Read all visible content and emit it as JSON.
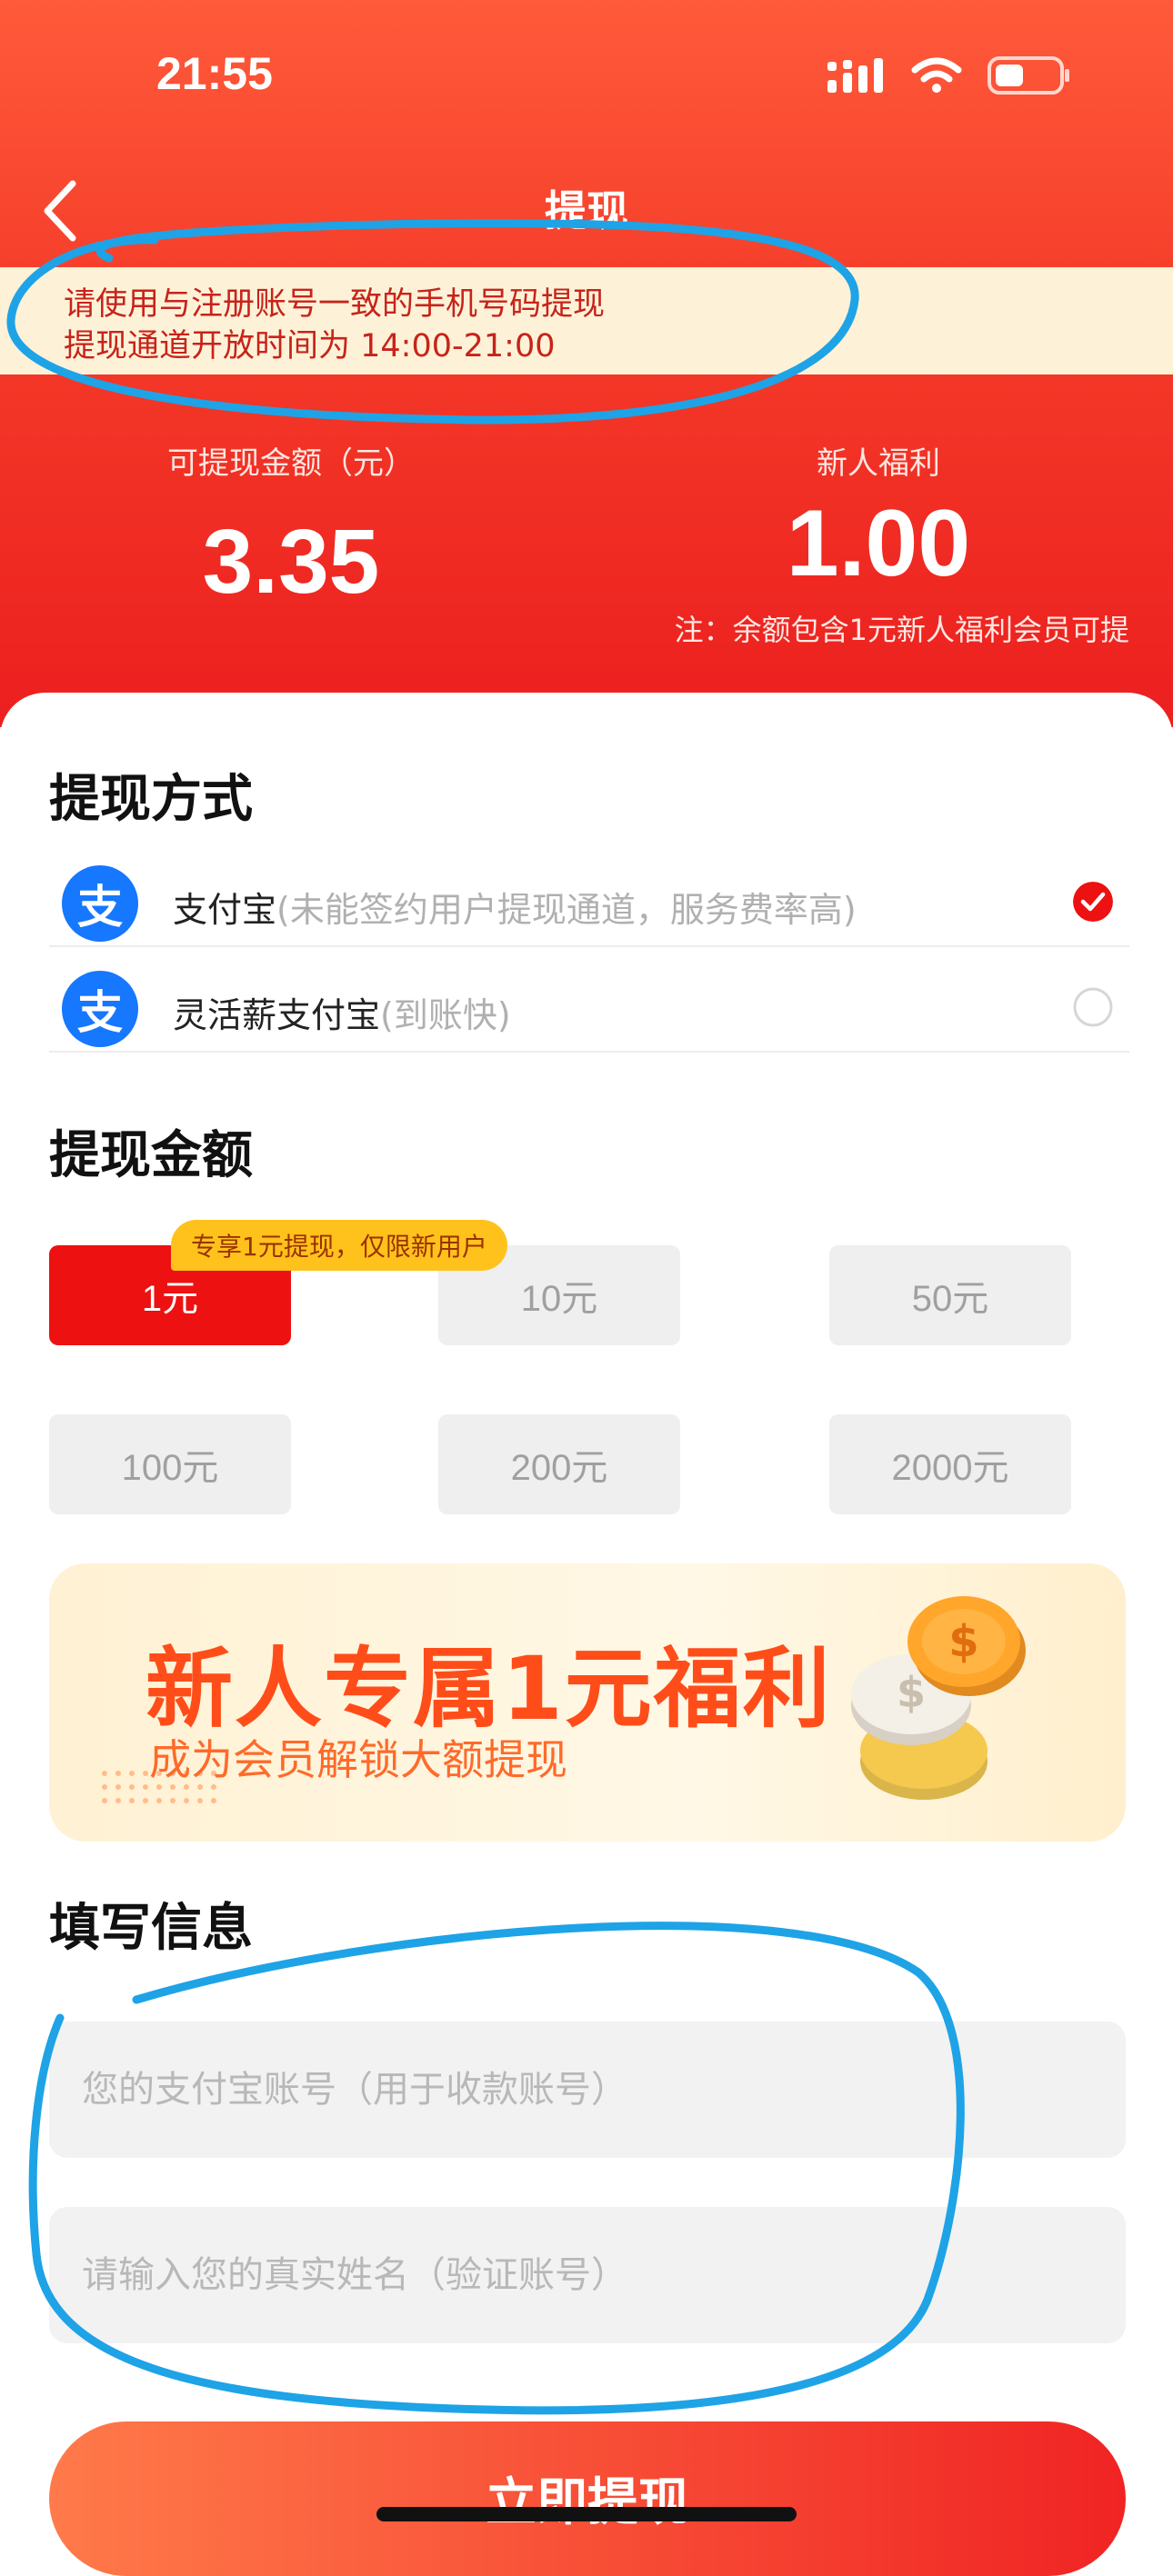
{
  "status_bar": {
    "time": "21:55"
  },
  "nav": {
    "title": "提现"
  },
  "notice": {
    "line1": "请使用与注册账号一致的手机号码提现",
    "line2": "提现通道开放时间为 14:00-21:00"
  },
  "balance": {
    "withdrawable_label": "可提现金额（元）",
    "withdrawable_value": "3.35",
    "bonus_label": "新人福利",
    "bonus_value": "1.00",
    "note": "注：余额包含1元新人福利会员可提"
  },
  "methods": {
    "title": "提现方式",
    "items": [
      {
        "logo": "支",
        "name": "支付宝",
        "sub": "(未能签约用户提现通道，服务费率高)",
        "selected": true
      },
      {
        "logo": "支",
        "name": "灵活薪支付宝",
        "sub": "(到账快)",
        "selected": false
      }
    ]
  },
  "amounts": {
    "title": "提现金额",
    "tag": "专享1元提现，仅限新用户",
    "options": [
      "1元",
      "10元",
      "50元",
      "100元",
      "200元",
      "2000元"
    ],
    "selected_index": 0
  },
  "banner": {
    "headline": "新人专属1元福利",
    "subline": "成为会员解锁大额提现"
  },
  "form": {
    "title": "填写信息",
    "account_placeholder": "您的支付宝账号（用于收款账号）",
    "name_placeholder": "请输入您的真实姓名（验证账号）"
  },
  "submit": {
    "label": "立即提现"
  },
  "colors": {
    "accent": "#ee1111",
    "alipay": "#1677ff",
    "annotation": "#1ea3e6"
  },
  "icons": [
    "signal-icon",
    "wifi-icon",
    "battery-icon",
    "back-arrow-icon",
    "alipay-icon",
    "check-icon",
    "coin-icon"
  ]
}
